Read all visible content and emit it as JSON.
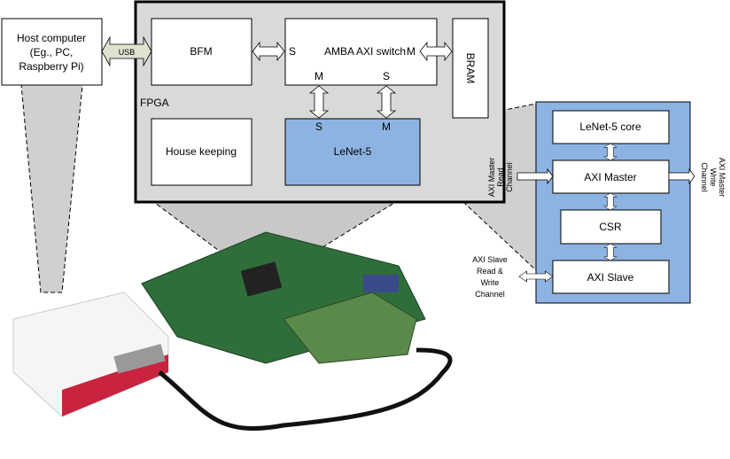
{
  "host": {
    "lines": [
      "Host computer",
      "(Eg., PC,",
      "Raspberry Pi)"
    ]
  },
  "usb_label": "USB",
  "fpga": {
    "label": "FPGA",
    "bfm": "BFM",
    "switch": "AMBA AXI switch",
    "switch_s": "S",
    "switch_m": "M",
    "switch_m_bottom": "M",
    "switch_s_bottom": "S",
    "bram": "BRAM",
    "housekeeping": "House keeping",
    "lenet": "LeNet-5",
    "lenet_s": "S",
    "lenet_m": "M"
  },
  "detail": {
    "core": "LeNet-5 core",
    "master": "AXI Master",
    "csr": "CSR",
    "slave": "AXI Slave",
    "read_channel": [
      "AXI Master",
      "Read",
      "Channel"
    ],
    "write_channel": [
      "AXI Master",
      "Write",
      "Channel"
    ],
    "slave_channel": [
      "AXI Slave",
      "Read &",
      "Write",
      "Channel"
    ]
  },
  "colors": {
    "fpga_fill": "#d9d9d9",
    "lenet_blue": "#8db3e2",
    "usb_arrow": "#dde3cf",
    "board_green": "#2f6e3a"
  }
}
